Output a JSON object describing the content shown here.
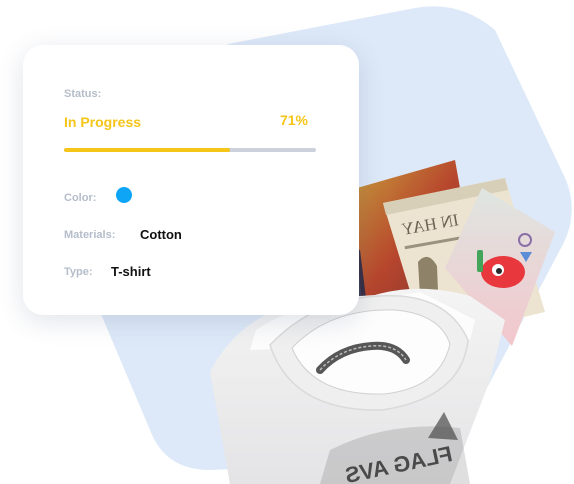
{
  "status_card": {
    "status_label": "Status:",
    "progress_state": "In Progress",
    "progress_percent": "71%",
    "progress_value": 0.66,
    "color_label": "Color:",
    "color_value": "#0ea5f7",
    "materials_label": "Materials:",
    "materials_value": "Cotton",
    "type_label": "Type:",
    "type_value": "T-shirt"
  },
  "colors": {
    "accent": "#f5c518",
    "hexagon_background": "#dde9f8"
  },
  "product_image": {
    "shirt_print_text": "FLAG AVS",
    "book_cover_text": "IN HAY"
  }
}
